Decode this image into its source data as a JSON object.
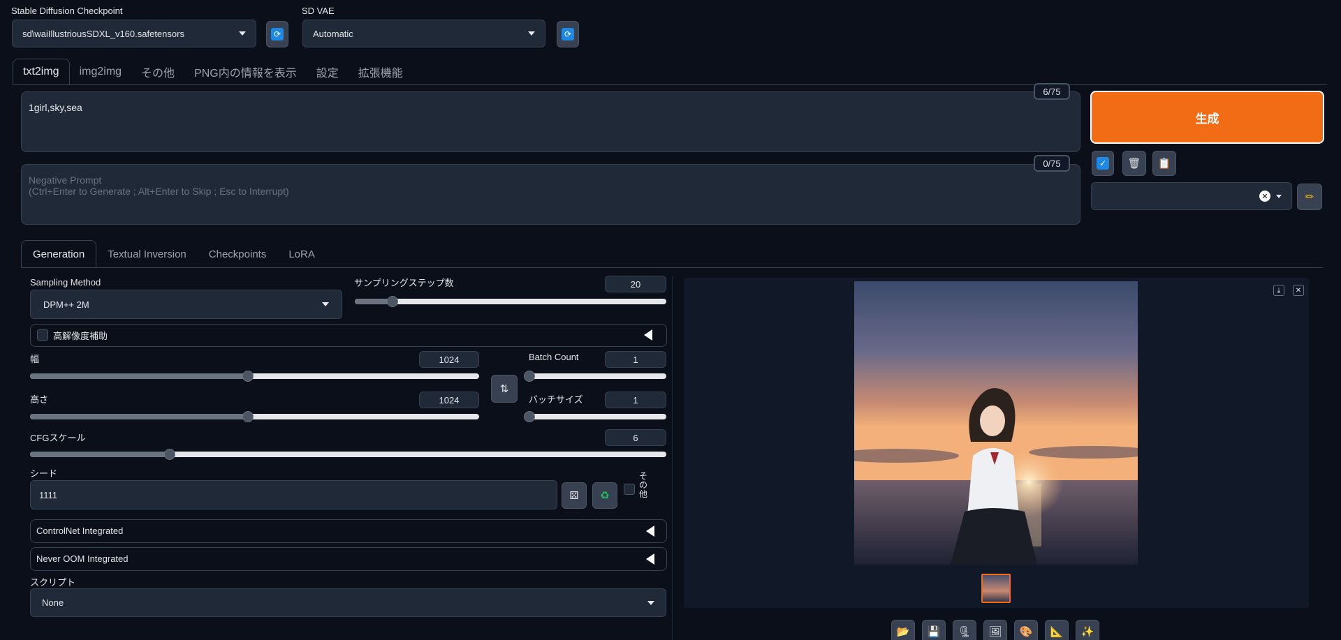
{
  "header": {
    "checkpoint_label": "Stable Diffusion Checkpoint",
    "checkpoint_value": "sd\\waiIllustriousSDXL_v160.safetensors",
    "vae_label": "SD VAE",
    "vae_value": "Automatic"
  },
  "tabs": [
    {
      "label": "txt2img",
      "active": true
    },
    {
      "label": "img2img"
    },
    {
      "label": "その他"
    },
    {
      "label": "PNG内の情報を表示"
    },
    {
      "label": "設定"
    },
    {
      "label": "拡張機能"
    }
  ],
  "prompt": {
    "value": "1girl,sky,sea",
    "counter": "6/75"
  },
  "negative_prompt": {
    "placeholder_line1": "Negative Prompt",
    "placeholder_line2": "(Ctrl+Enter to Generate ; Alt+Enter to Skip ; Esc to Interrupt)",
    "counter": "0/75"
  },
  "generate": {
    "label": "生成",
    "color": "#f26b15"
  },
  "subtabs": [
    {
      "label": "Generation",
      "active": true
    },
    {
      "label": "Textual Inversion"
    },
    {
      "label": "Checkpoints"
    },
    {
      "label": "LoRA"
    }
  ],
  "params": {
    "sampling_method_label": "Sampling Method",
    "sampling_method_value": "DPM++ 2M",
    "steps_label": "サンプリングステップ数",
    "steps_value": "20",
    "steps_fraction": 0.12,
    "hires_label": "高解像度補助",
    "width_label": "幅",
    "width_value": "1024",
    "width_fraction": 0.485,
    "height_label": "高さ",
    "height_value": "1024",
    "height_fraction": 0.485,
    "batch_count_label": "Batch Count",
    "batch_count_value": "1",
    "batch_count_fraction": 0.0,
    "batch_size_label": "バッチサイズ",
    "batch_size_value": "1",
    "batch_size_fraction": 0.0,
    "cfg_label": "CFGスケール",
    "cfg_value": "6",
    "cfg_fraction": 0.22,
    "seed_label": "シード",
    "seed_value": "1111",
    "extra_label": "その他",
    "controlnet_label": "ControlNet Integrated",
    "neveroom_label": "Never OOM Integrated",
    "script_label": "スクリプト",
    "script_value": "None"
  },
  "icons": {
    "refresh": "refresh-icon",
    "dice": "dice-icon",
    "recycle": "recycle-icon",
    "trash": "trash-icon",
    "clipboard": "clipboard-icon",
    "pencil": "pencil-icon",
    "swap": "swap-icon",
    "folder": "folder-icon",
    "save": "save-icon",
    "zip": "zip-icon",
    "image": "image-icon",
    "palette": "palette-icon",
    "ruler": "ruler-icon",
    "sparkle": "sparkle-icon"
  }
}
